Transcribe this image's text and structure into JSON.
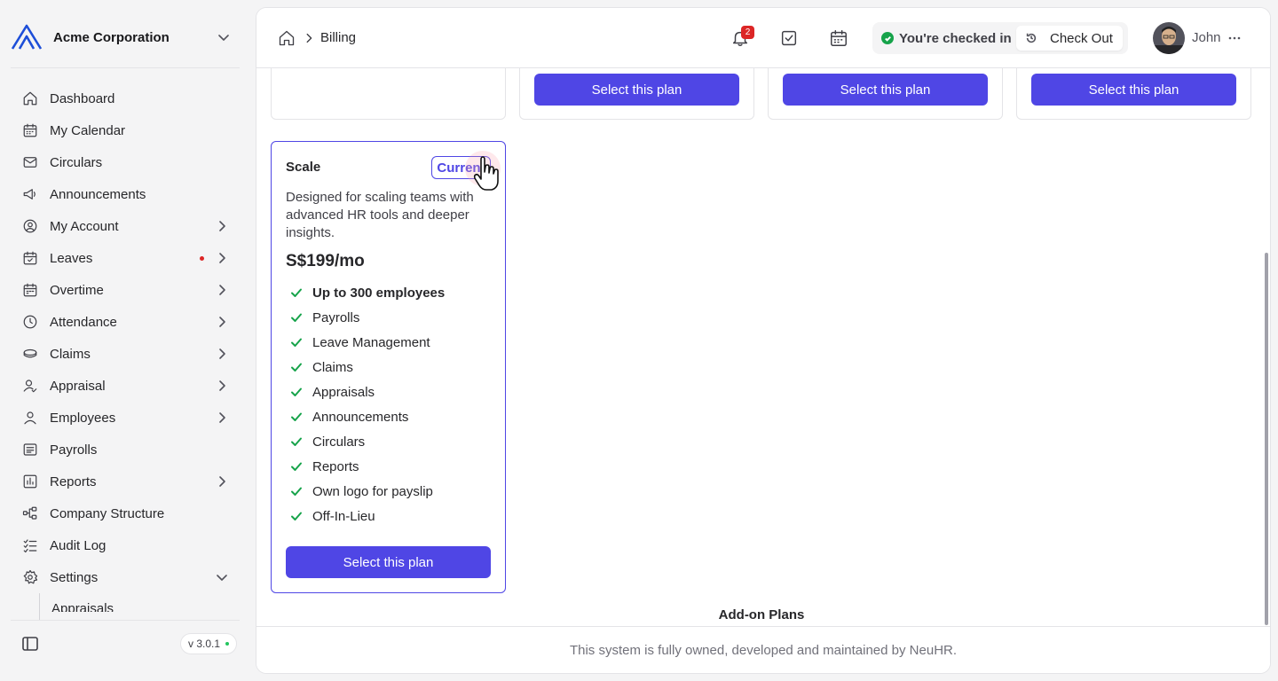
{
  "sidebar": {
    "org_name": "Acme Corporation",
    "nav": [
      {
        "label": "Dashboard",
        "icon": "home-icon",
        "chevron": false
      },
      {
        "label": "My Calendar",
        "icon": "calendar-icon",
        "chevron": false
      },
      {
        "label": "Circulars",
        "icon": "mail-icon",
        "chevron": false
      },
      {
        "label": "Announcements",
        "icon": "megaphone-icon",
        "chevron": false
      },
      {
        "label": "My Account",
        "icon": "user-circle-icon",
        "chevron": true
      },
      {
        "label": "Leaves",
        "icon": "calendar-check-icon",
        "chevron": true,
        "dot": true
      },
      {
        "label": "Overtime",
        "icon": "calendar-clock-icon",
        "chevron": true
      },
      {
        "label": "Attendance",
        "icon": "clock-icon",
        "chevron": true
      },
      {
        "label": "Claims",
        "icon": "coins-icon",
        "chevron": true
      },
      {
        "label": "Appraisal",
        "icon": "user-check-icon",
        "chevron": true
      },
      {
        "label": "Employees",
        "icon": "user-icon",
        "chevron": true
      },
      {
        "label": "Payrolls",
        "icon": "receipt-icon",
        "chevron": false
      },
      {
        "label": "Reports",
        "icon": "chart-icon",
        "chevron": true
      },
      {
        "label": "Company Structure",
        "icon": "hierarchy-icon",
        "chevron": false
      },
      {
        "label": "Audit Log",
        "icon": "list-check-icon",
        "chevron": false
      },
      {
        "label": "Settings",
        "icon": "gear-icon",
        "chevron": true,
        "expanded": true
      }
    ],
    "sub_peek": "Appraisals",
    "version": "v 3.0.1"
  },
  "header": {
    "breadcrumb": "Billing",
    "notification_count": "2",
    "checkin_status": "You're checked in",
    "checkout_label": "Check Out",
    "user_name": "John"
  },
  "plans": {
    "select_label": "Select this plan",
    "current_plan": {
      "name": "Scale",
      "badge": "Current",
      "description": "Designed for scaling teams with advanced HR tools and deeper insights.",
      "price": "S$199/mo",
      "features": [
        {
          "text": "Up to 300 employees",
          "bold": true
        },
        {
          "text": "Payrolls",
          "bold": false
        },
        {
          "text": "Leave Management",
          "bold": false
        },
        {
          "text": "Claims",
          "bold": false
        },
        {
          "text": "Appraisals",
          "bold": false
        },
        {
          "text": "Announcements",
          "bold": false
        },
        {
          "text": "Circulars",
          "bold": false
        },
        {
          "text": "Reports",
          "bold": false
        },
        {
          "text": "Own logo for payslip",
          "bold": false
        },
        {
          "text": "Off-In-Lieu",
          "bold": false
        }
      ]
    },
    "addon_title": "Add-on Plans"
  },
  "footer": {
    "text": "This system is fully owned, developed and maintained by NeuHR."
  },
  "colors": {
    "accent": "#4f46e5",
    "check": "#16a34a",
    "alert": "#dc2626"
  }
}
